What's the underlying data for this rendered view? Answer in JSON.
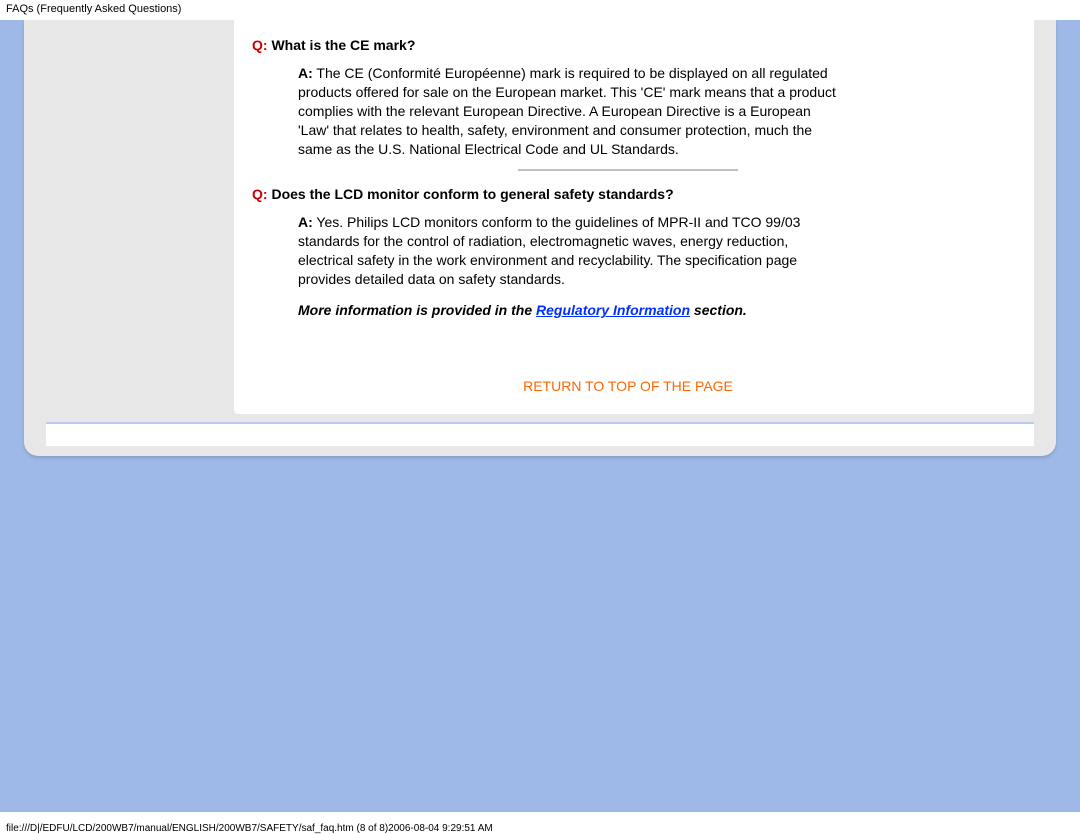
{
  "header_strip": "FAQs (Frequently Asked Questions)",
  "faq1": {
    "q_prefix": "Q:",
    "q_text": " What is the CE mark?",
    "a_prefix": "A:",
    "a_text": " The CE (Conformité Européenne) mark is required to be displayed on all regulated products offered for sale on the European market. This 'CE' mark means that a product complies with the relevant European Directive. A European Directive is a European 'Law' that relates to health, safety, environment and consumer protection, much the same as the U.S. National Electrical Code and UL Standards."
  },
  "faq2": {
    "q_prefix": "Q:",
    "q_text": " Does the LCD monitor conform to general safety standards?",
    "a_prefix": "A:",
    "a_text": " Yes. Philips LCD monitors conform to the guidelines of MPR-II and TCO 99/03 standards for the control of radiation, electromagnetic waves, energy reduction, electrical safety in the work environment and recyclability. The specification page provides detailed data on safety standards."
  },
  "more_info": {
    "pre": "More information is provided in the ",
    "link": "Regulatory Information",
    "post": " section."
  },
  "return_top": "RETURN TO TOP OF THE PAGE",
  "footer_path": "file:///D|/EDFU/LCD/200WB7/manual/ENGLISH/200WB7/SAFETY/saf_faq.htm (8 of 8)2006-08-04 9:29:51 AM"
}
